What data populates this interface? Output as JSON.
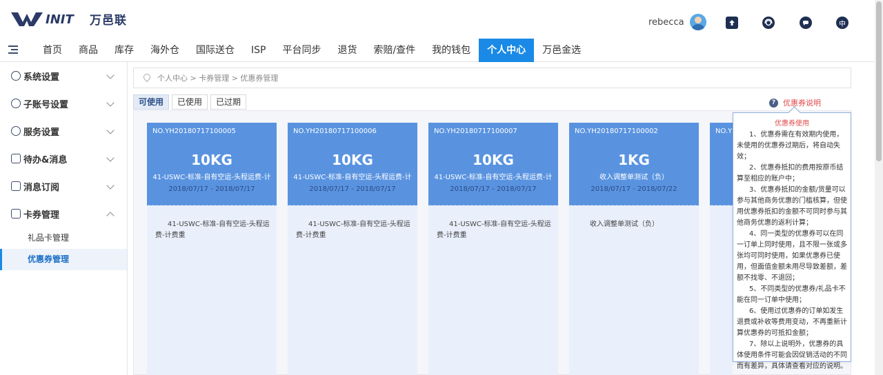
{
  "brand": {
    "logo_en": "INIT",
    "logo_cn": "万邑联"
  },
  "header": {
    "username": "rebecca",
    "icons": [
      "upload-icon",
      "service-icon",
      "message-icon",
      "language-icon"
    ],
    "lang_label": "中"
  },
  "nav": {
    "items": [
      {
        "label": "首页"
      },
      {
        "label": "商品"
      },
      {
        "label": "库存"
      },
      {
        "label": "海外仓"
      },
      {
        "label": "国际送仓"
      },
      {
        "label": "ISP"
      },
      {
        "label": "平台同步"
      },
      {
        "label": "退货"
      },
      {
        "label": "索赔/查件"
      },
      {
        "label": "我的钱包"
      },
      {
        "label": "个人中心"
      },
      {
        "label": "万邑金选"
      }
    ],
    "active_index": 10
  },
  "sidebar": {
    "groups": [
      {
        "label": "系统设置"
      },
      {
        "label": "子账号设置"
      },
      {
        "label": "服务设置"
      },
      {
        "label": "待办&消息"
      },
      {
        "label": "消息订阅"
      },
      {
        "label": "卡券管理"
      }
    ],
    "sub_items": [
      {
        "label": "礼品卡管理"
      },
      {
        "label": "优惠券管理"
      }
    ]
  },
  "breadcrumb": "个人中心 > 卡券管理 > 优惠券管理",
  "tabs": [
    {
      "label": "可使用"
    },
    {
      "label": "已使用"
    },
    {
      "label": "已过期"
    }
  ],
  "help_label": "优惠券说明",
  "coupons": [
    {
      "no": "NO.YH20180717100005",
      "amount": "10KG",
      "name": "41-USWC-标准-自有空运-头程运费-计",
      "date": "2018/07/17 - 2018/07/17",
      "desc": "41-USWC-标准-自有空运-头程运费-计费重"
    },
    {
      "no": "NO.YH20180717100006",
      "amount": "10KG",
      "name": "41-USWC-标准-自有空运-头程运费-计",
      "date": "2018/07/17 - 2018/07/17",
      "desc": "41-USWC-标准-自有空运-头程运费-计费重"
    },
    {
      "no": "NO.YH20180717100007",
      "amount": "10KG",
      "name": "41-USWC-标准-自有空运-头程运费-计",
      "date": "2018/07/17 - 2018/07/17",
      "desc": "41-USWC-标准-自有空运-头程运费-计费重"
    },
    {
      "no": "NO.YH20180717100002",
      "amount": "1KG",
      "name": "收入调整单测试（负）",
      "date": "2018/07/17 - 2018/07/22",
      "desc": "收入调整单测试（负）"
    },
    {
      "no": "NO.Y",
      "amount": "",
      "name": "",
      "date": "",
      "desc": ""
    }
  ],
  "tooltip": {
    "title": "优惠券使用",
    "paragraphs": [
      "1、优惠券需在有效期内使用，未使用的优惠券过期后，将自动失效；",
      "2、优惠券抵扣的费用按原币结算至相应的账户中；",
      "3、优惠券抵扣的金额/货量可以参与其他商务优惠的门槛核算，但使用优惠券抵扣的金额不可同时参与其他商务优惠的返利计算；",
      "4、同一类型的优惠券可以在同一订单上同时使用，且不限一张或多张均可同时使用，如果优惠券已使用，但面值金额未用尽导致差额，差额不找零、不退回；",
      "5、不同类型的优惠券/礼品卡不能在同一订单中使用；",
      "6、使用过优惠券的订单如发生退费或补收等费用变动，不再重新计算优惠券的可抵扣金额；",
      "7、除以上说明外，优惠券的具体使用条件可能会因促销活动的不同而有差异，具体请查看对应的说明。"
    ]
  },
  "colors": {
    "accent": "#1a8ae6",
    "card_top": "#5993e0",
    "card_body": "#e9f0fb",
    "help_red": "#e04a4a"
  }
}
